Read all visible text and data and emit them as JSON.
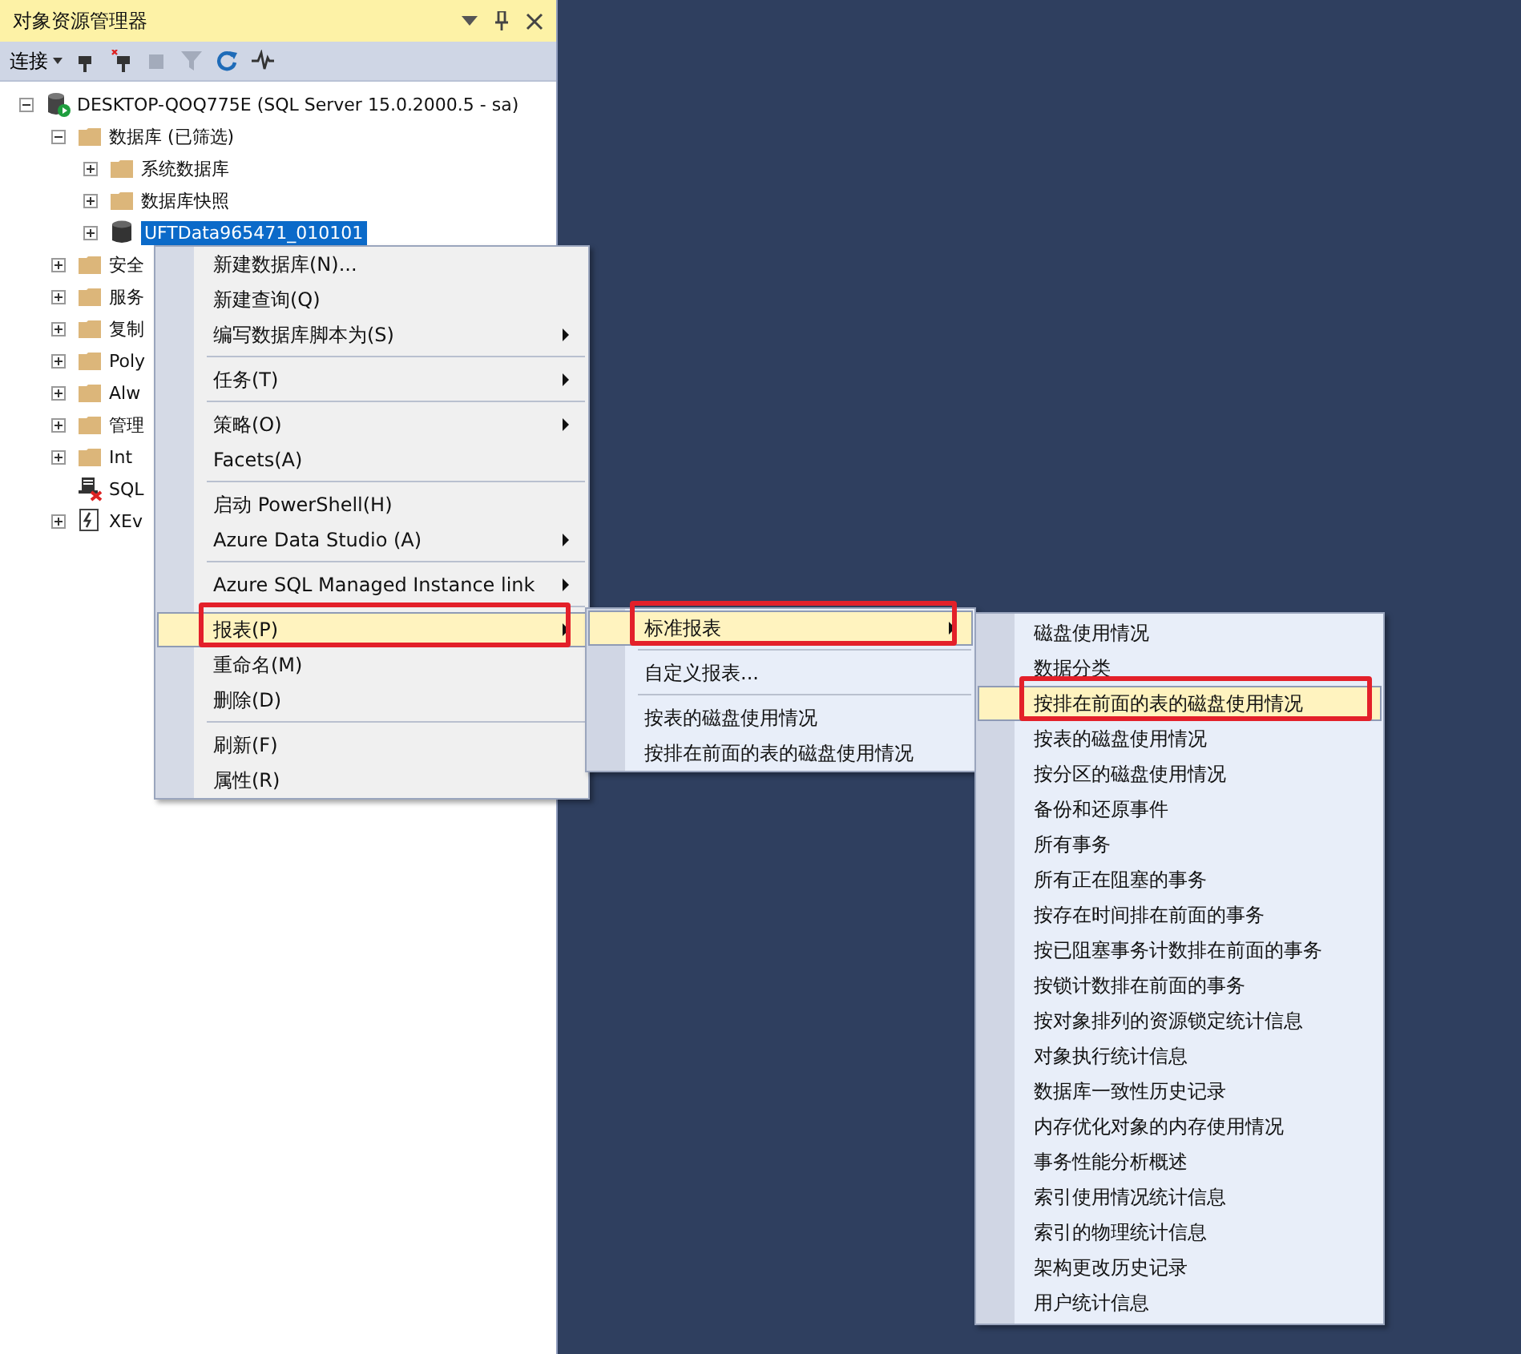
{
  "panel": {
    "title": "对象资源管理器",
    "toolbar": {
      "connect_label": "连接",
      "buttons": [
        {
          "kind": "plug",
          "disabled": false
        },
        {
          "kind": "plug-x",
          "disabled": false
        },
        {
          "kind": "stop",
          "disabled": true
        },
        {
          "kind": "filter",
          "disabled": true
        },
        {
          "kind": "refresh",
          "disabled": false
        },
        {
          "kind": "activity",
          "disabled": false
        }
      ]
    },
    "tree": [
      {
        "label": "DESKTOP-QOQ775E (SQL Server 15.0.2000.5 - sa)",
        "kind": "server",
        "expanded": true,
        "selected": false,
        "children": [
          {
            "label": "数据库 (已筛选)",
            "kind": "folder",
            "expanded": true,
            "selected": false,
            "children": [
              {
                "label": "系统数据库",
                "kind": "folder",
                "expanded": false,
                "selected": false
              },
              {
                "label": "数据库快照",
                "kind": "folder",
                "expanded": false,
                "selected": false
              },
              {
                "label": "UFTData965471_010101",
                "kind": "database",
                "expanded": false,
                "selected": true
              }
            ]
          },
          {
            "label": "安全",
            "kind": "folder",
            "expanded": false,
            "selected": false
          },
          {
            "label": "服务",
            "kind": "folder",
            "expanded": false,
            "selected": false
          },
          {
            "label": "复制",
            "kind": "folder",
            "expanded": false,
            "selected": false
          },
          {
            "label": "Poly",
            "kind": "folder",
            "expanded": false,
            "selected": false
          },
          {
            "label": "Alw",
            "kind": "folder",
            "expanded": false,
            "selected": false
          },
          {
            "label": "管理",
            "kind": "folder",
            "expanded": false,
            "selected": false
          },
          {
            "label": "Int",
            "kind": "folder",
            "expanded": false,
            "selected": false
          },
          {
            "label": "SQL",
            "kind": "agent",
            "selected": false
          },
          {
            "label": "XEv",
            "kind": "xevent",
            "expanded": false,
            "selected": false
          }
        ]
      }
    ]
  },
  "menus": [
    {
      "items": [
        {
          "kind": "item",
          "label": "新建数据库(N)...",
          "submenu": false,
          "selected": false,
          "marked": false
        },
        {
          "kind": "item",
          "label": "新建查询(Q)",
          "submenu": false,
          "selected": false,
          "marked": false
        },
        {
          "kind": "item",
          "label": "编写数据库脚本为(S)",
          "submenu": true,
          "selected": false,
          "marked": false
        },
        {
          "kind": "separator"
        },
        {
          "kind": "item",
          "label": "任务(T)",
          "submenu": true,
          "selected": false,
          "marked": false
        },
        {
          "kind": "separator"
        },
        {
          "kind": "item",
          "label": "策略(O)",
          "submenu": true,
          "selected": false,
          "marked": false
        },
        {
          "kind": "item",
          "label": "Facets(A)",
          "submenu": false,
          "selected": false,
          "marked": false
        },
        {
          "kind": "separator"
        },
        {
          "kind": "item",
          "label": "启动 PowerShell(H)",
          "submenu": false,
          "selected": false,
          "marked": false
        },
        {
          "kind": "item",
          "label": "Azure Data Studio (A)",
          "submenu": true,
          "selected": false,
          "marked": false
        },
        {
          "kind": "separator"
        },
        {
          "kind": "item",
          "label": "Azure SQL Managed Instance link",
          "submenu": true,
          "selected": false,
          "marked": false
        },
        {
          "kind": "separator"
        },
        {
          "kind": "item",
          "label": "报表(P)",
          "submenu": true,
          "selected": true,
          "marked": true
        },
        {
          "kind": "item",
          "label": "重命名(M)",
          "submenu": false,
          "selected": false,
          "marked": false
        },
        {
          "kind": "item",
          "label": "删除(D)",
          "submenu": false,
          "selected": false,
          "marked": false
        },
        {
          "kind": "separator"
        },
        {
          "kind": "item",
          "label": "刷新(F)",
          "submenu": false,
          "selected": false,
          "marked": false
        },
        {
          "kind": "item",
          "label": "属性(R)",
          "submenu": false,
          "selected": false,
          "marked": false
        }
      ]
    },
    {
      "items": [
        {
          "kind": "item",
          "label": "标准报表",
          "submenu": true,
          "selected": true,
          "marked": true
        },
        {
          "kind": "separator"
        },
        {
          "kind": "item",
          "label": "自定义报表...",
          "submenu": false,
          "selected": false,
          "marked": false
        },
        {
          "kind": "separator"
        },
        {
          "kind": "item",
          "label": "按表的磁盘使用情况",
          "submenu": false,
          "selected": false,
          "marked": false
        },
        {
          "kind": "item",
          "label": "按排在前面的表的磁盘使用情况",
          "submenu": false,
          "selected": false,
          "marked": false
        }
      ]
    },
    {
      "items": [
        {
          "kind": "item",
          "label": "磁盘使用情况",
          "submenu": false,
          "selected": false,
          "marked": false
        },
        {
          "kind": "item",
          "label": "数据分类",
          "submenu": false,
          "selected": false,
          "marked": false
        },
        {
          "kind": "item",
          "label": "按排在前面的表的磁盘使用情况",
          "submenu": false,
          "selected": true,
          "marked": true
        },
        {
          "kind": "item",
          "label": "按表的磁盘使用情况",
          "submenu": false,
          "selected": false,
          "marked": false
        },
        {
          "kind": "item",
          "label": "按分区的磁盘使用情况",
          "submenu": false,
          "selected": false,
          "marked": false
        },
        {
          "kind": "item",
          "label": "备份和还原事件",
          "submenu": false,
          "selected": false,
          "marked": false
        },
        {
          "kind": "item",
          "label": "所有事务",
          "submenu": false,
          "selected": false,
          "marked": false
        },
        {
          "kind": "item",
          "label": "所有正在阻塞的事务",
          "submenu": false,
          "selected": false,
          "marked": false
        },
        {
          "kind": "item",
          "label": "按存在时间排在前面的事务",
          "submenu": false,
          "selected": false,
          "marked": false
        },
        {
          "kind": "item",
          "label": "按已阻塞事务计数排在前面的事务",
          "submenu": false,
          "selected": false,
          "marked": false
        },
        {
          "kind": "item",
          "label": "按锁计数排在前面的事务",
          "submenu": false,
          "selected": false,
          "marked": false
        },
        {
          "kind": "item",
          "label": "按对象排列的资源锁定统计信息",
          "submenu": false,
          "selected": false,
          "marked": false
        },
        {
          "kind": "item",
          "label": "对象执行统计信息",
          "submenu": false,
          "selected": false,
          "marked": false
        },
        {
          "kind": "item",
          "label": "数据库一致性历史记录",
          "submenu": false,
          "selected": false,
          "marked": false
        },
        {
          "kind": "item",
          "label": "内存优化对象的内存使用情况",
          "submenu": false,
          "selected": false,
          "marked": false
        },
        {
          "kind": "item",
          "label": "事务性能分析概述",
          "submenu": false,
          "selected": false,
          "marked": false
        },
        {
          "kind": "item",
          "label": "索引使用情况统计信息",
          "submenu": false,
          "selected": false,
          "marked": false
        },
        {
          "kind": "item",
          "label": "索引的物理统计信息",
          "submenu": false,
          "selected": false,
          "marked": false
        },
        {
          "kind": "item",
          "label": "架构更改历史记录",
          "submenu": false,
          "selected": false,
          "marked": false
        },
        {
          "kind": "item",
          "label": "用户统计信息",
          "submenu": false,
          "selected": false,
          "marked": false
        }
      ]
    }
  ]
}
